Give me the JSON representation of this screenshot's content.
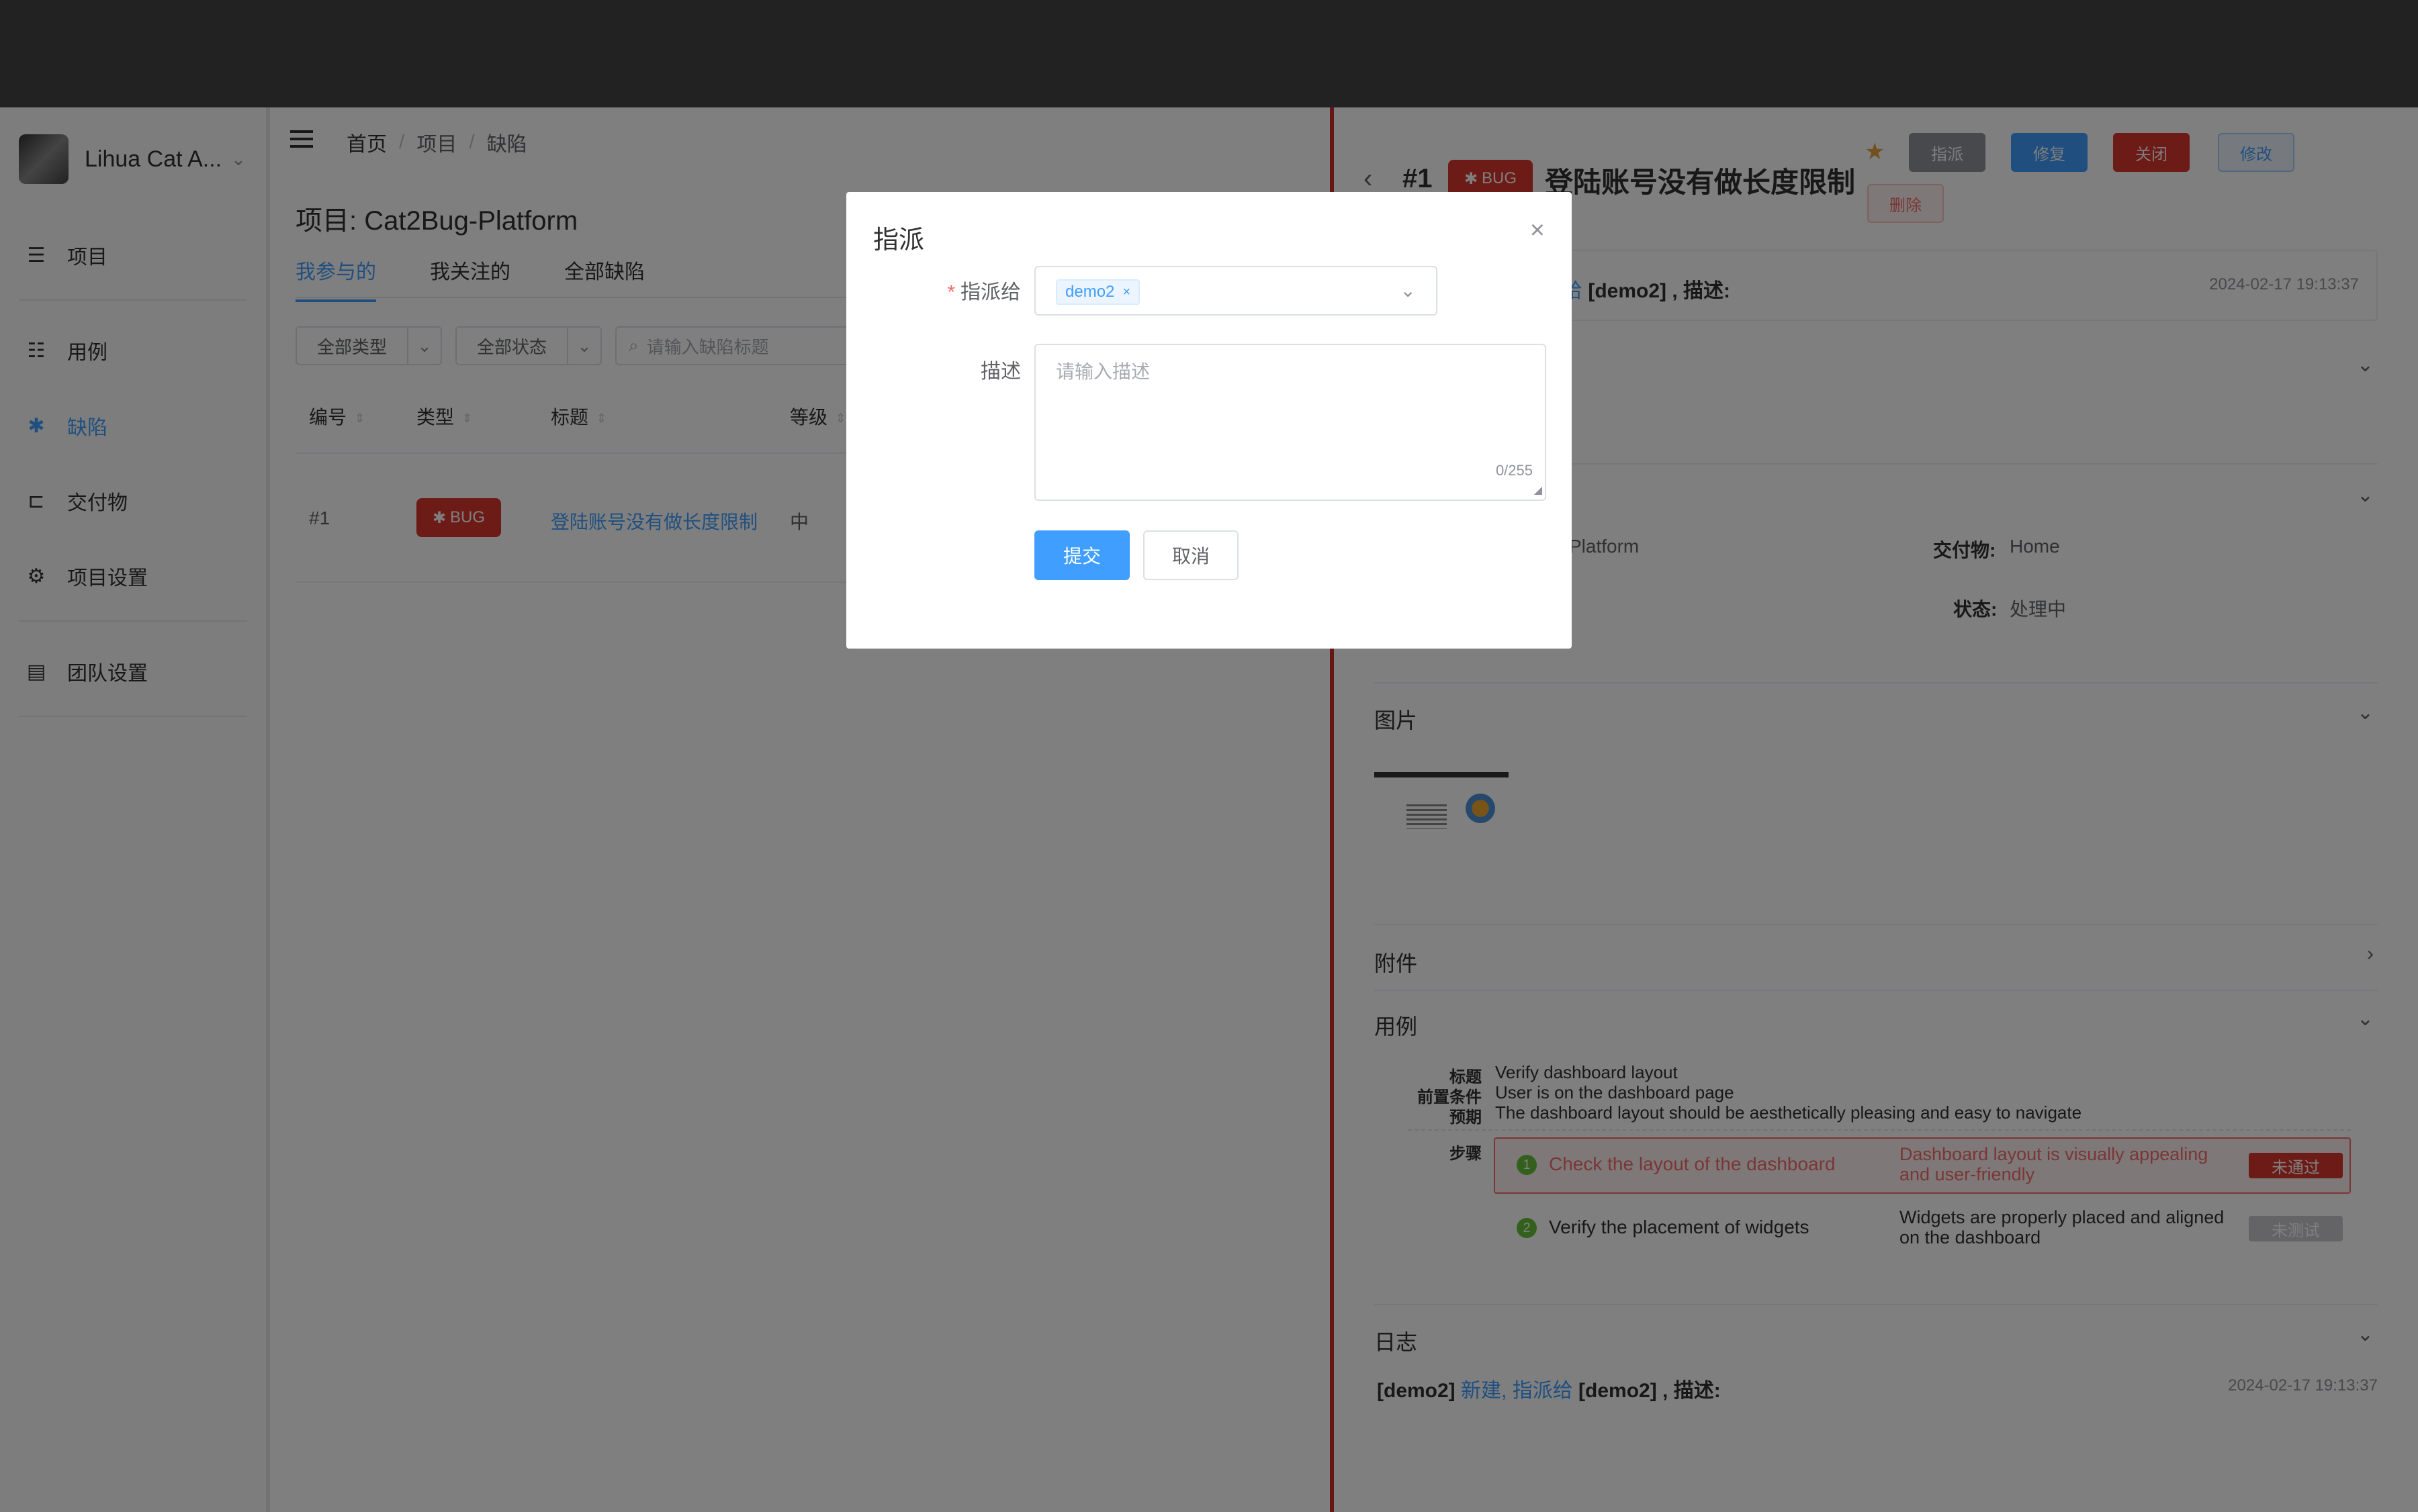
{
  "sidebar": {
    "team_name": "Lihua Cat A...",
    "items": [
      {
        "label": "项目",
        "icon": "list-icon"
      },
      {
        "label": "用例",
        "icon": "list-tree-icon"
      },
      {
        "label": "缺陷",
        "icon": "bug-icon"
      },
      {
        "label": "交付物",
        "icon": "deliverable-icon"
      },
      {
        "label": "项目设置",
        "icon": "gear-icon"
      },
      {
        "label": "团队设置",
        "icon": "team-settings-icon"
      }
    ]
  },
  "breadcrumb": [
    "首页",
    "项目",
    "缺陷"
  ],
  "project": {
    "title": "项目: Cat2Bug-Platform"
  },
  "tabs": [
    "我参与的",
    "我关注的",
    "全部缺陷"
  ],
  "filters": {
    "type": "全部类型",
    "status": "全部状态",
    "search_placeholder": "请输入缺陷标题"
  },
  "table": {
    "columns": [
      "编号",
      "类型",
      "标题",
      "等级"
    ],
    "rows": [
      {
        "id": "#1",
        "type": "BUG",
        "title": "登陆账号没有做长度限制",
        "level": "中"
      }
    ]
  },
  "drawer": {
    "id": "#1",
    "type": "BUG",
    "title": "登陆账号没有做长度限制",
    "buttons": {
      "assign": "指派",
      "fix": "修复",
      "close": "关闭",
      "edit": "修改",
      "delete": "删除"
    },
    "top_log": {
      "text_link": "给",
      "text": "[demo2] , 描述:",
      "time": "2024-02-17 19:13:37"
    },
    "info": {
      "project_partial": "Platform",
      "deliverable_label": "交付物:",
      "deliverable_value": "Home",
      "status_label": "状态:",
      "status_value": "处理中"
    },
    "sections": {
      "images": "图片",
      "attachments": "附件",
      "cases": "用例",
      "logs": "日志"
    },
    "case": {
      "title_label": "标题",
      "title": "Verify dashboard layout",
      "pre_label": "前置条件",
      "pre": "User is on the dashboard page",
      "expect_label": "预期",
      "expect": "The dashboard layout should be aesthetically pleasing and easy to navigate",
      "steps_label": "步骤",
      "steps": [
        {
          "num": "1",
          "action": "Check the layout of the dashboard",
          "expected_1": "Dashboard layout is visually appealing",
          "expected_2": "and user-friendly",
          "result": "未通过"
        },
        {
          "num": "2",
          "action": "Verify the placement of widgets",
          "expected_1": "Widgets are properly placed and aligned",
          "expected_2": "on the dashboard",
          "result": "未测试"
        }
      ]
    },
    "log": {
      "user": "[demo2]",
      "action": "新建, 指派给",
      "target": "[demo2] , 描述:",
      "time": "2024-02-17 19:13:37"
    }
  },
  "modal": {
    "title": "指派",
    "assign_label": "指派给",
    "assignee": "demo2",
    "desc_label": "描述",
    "desc_placeholder": "请输入描述",
    "desc_count": "0/255",
    "submit": "提交",
    "cancel": "取消"
  },
  "colors": {
    "accent": "#409eff",
    "danger": "#d9362e",
    "success": "#67c23a"
  }
}
